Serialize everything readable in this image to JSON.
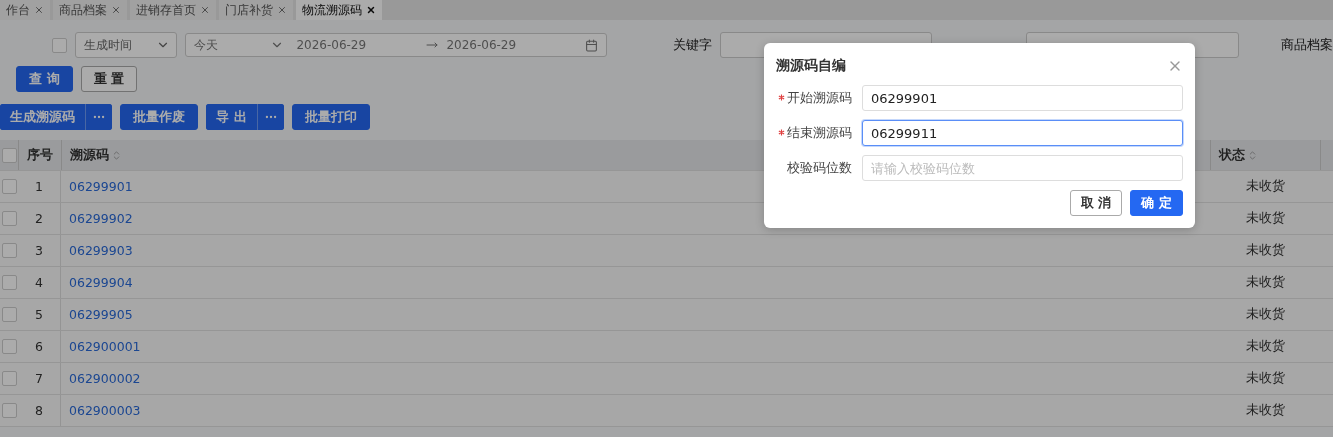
{
  "tabs": [
    {
      "label": "作台",
      "selected": false
    },
    {
      "label": "商品档案",
      "selected": false
    },
    {
      "label": "进销存首页",
      "selected": false
    },
    {
      "label": "门店补货",
      "selected": false
    },
    {
      "label": "物流溯源码",
      "selected": true
    }
  ],
  "filters": {
    "checked": false,
    "time_type": "生成时间",
    "range_preset": "今天",
    "start_date": "2026-06-29",
    "end_date": "2026-06-29",
    "keyword_label": "关键字",
    "right_label": "商品档案"
  },
  "search_buttons": {
    "query": "查 询",
    "reset": "重 置"
  },
  "actions": [
    {
      "label": "生成溯源码",
      "kind": "split"
    },
    {
      "label": "批量作废",
      "kind": "plain"
    },
    {
      "label": "导 出",
      "kind": "split"
    },
    {
      "label": "批量打印",
      "kind": "plain"
    }
  ],
  "table": {
    "all_checked": false,
    "columns": [
      "序号",
      "溯源码",
      "状态"
    ],
    "rows": [
      {
        "checked": false,
        "index": "1",
        "code": "06299901",
        "status": "未收货"
      },
      {
        "checked": false,
        "index": "2",
        "code": "06299902",
        "status": "未收货"
      },
      {
        "checked": false,
        "index": "3",
        "code": "06299903",
        "status": "未收货"
      },
      {
        "checked": false,
        "index": "4",
        "code": "06299904",
        "status": "未收货"
      },
      {
        "checked": false,
        "index": "5",
        "code": "06299905",
        "status": "未收货"
      },
      {
        "checked": false,
        "index": "6",
        "code": "062900001",
        "status": "未收货"
      },
      {
        "checked": false,
        "index": "7",
        "code": "062900002",
        "status": "未收货"
      },
      {
        "checked": false,
        "index": "8",
        "code": "062900003",
        "status": "未收货"
      }
    ]
  },
  "dialog": {
    "title": "溯源码自编",
    "fields": [
      {
        "label": "开始溯源码",
        "required": true,
        "value": "06299901",
        "focused": false
      },
      {
        "label": "结束溯源码",
        "required": true,
        "value": "06299911",
        "focused": true
      },
      {
        "label": "校验码位数",
        "required": false,
        "placeholder": "请输入校验码位数",
        "focused": false
      }
    ],
    "cancel": "取 消",
    "ok": "确 定"
  }
}
